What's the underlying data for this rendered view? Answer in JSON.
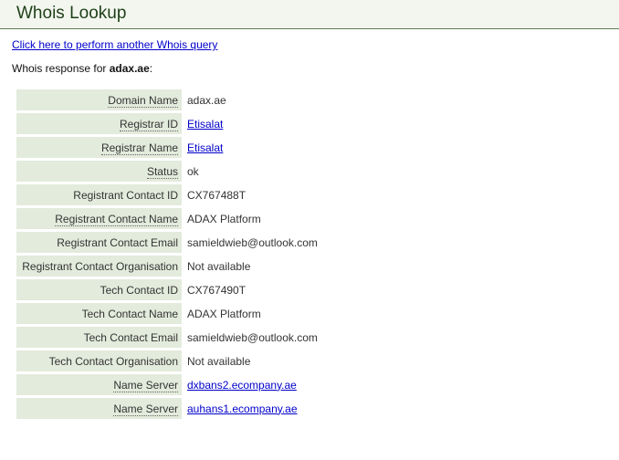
{
  "header": {
    "title": "Whois Lookup"
  },
  "query_link": {
    "label": "Click here to perform another Whois query"
  },
  "response": {
    "prefix": "Whois response for ",
    "domain": "adax.ae",
    "suffix": ":"
  },
  "rows": [
    {
      "label": "Domain Name",
      "value": "adax.ae",
      "label_dotted": true,
      "value_link": false
    },
    {
      "label": "Registrar ID",
      "value": "Etisalat",
      "label_dotted": true,
      "value_link": true
    },
    {
      "label": "Registrar Name",
      "value": "Etisalat",
      "label_dotted": true,
      "value_link": true
    },
    {
      "label": "Status",
      "value": "ok",
      "label_dotted": true,
      "value_link": false
    },
    {
      "label": "Registrant Contact ID",
      "value": "CX767488T",
      "label_dotted": false,
      "value_link": false
    },
    {
      "label": "Registrant Contact Name",
      "value": "ADAX Platform",
      "label_dotted": true,
      "value_link": false
    },
    {
      "label": "Registrant Contact Email",
      "value": "samieldwieb@outlook.com",
      "label_dotted": false,
      "value_link": false
    },
    {
      "label": "Registrant Contact Organisation",
      "value": "Not available",
      "label_dotted": false,
      "value_link": false
    },
    {
      "label": "Tech Contact ID",
      "value": "CX767490T",
      "label_dotted": false,
      "value_link": false
    },
    {
      "label": "Tech Contact Name",
      "value": "ADAX Platform",
      "label_dotted": false,
      "value_link": false
    },
    {
      "label": "Tech Contact Email",
      "value": "samieldwieb@outlook.com",
      "label_dotted": false,
      "value_link": false
    },
    {
      "label": "Tech Contact Organisation",
      "value": "Not available",
      "label_dotted": false,
      "value_link": false
    },
    {
      "label": "Name Server",
      "value": "dxbans2.ecompany.ae",
      "label_dotted": true,
      "value_link": true
    },
    {
      "label": "Name Server",
      "value": "auhans1.ecompany.ae",
      "label_dotted": true,
      "value_link": true
    }
  ]
}
